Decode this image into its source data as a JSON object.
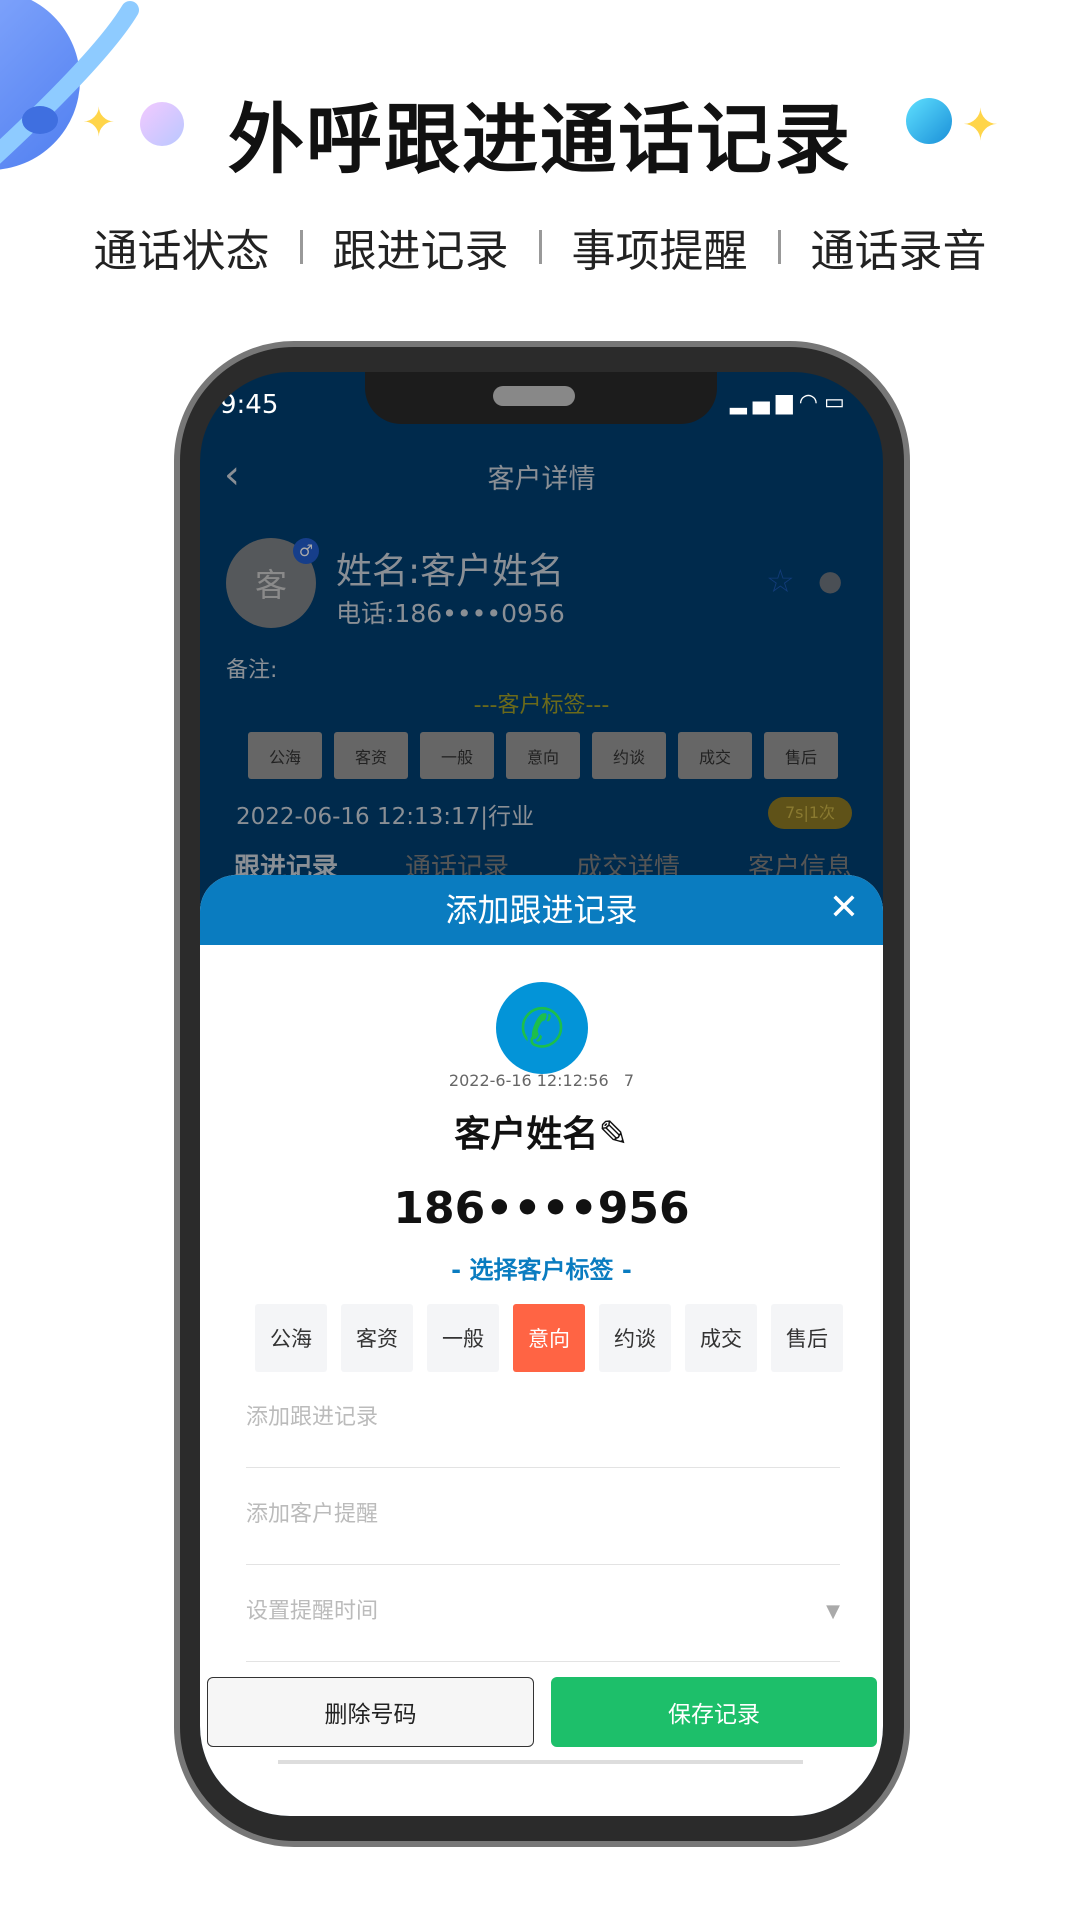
{
  "banner": {
    "title": "外呼跟进通话记录",
    "features": [
      "通话状态",
      "跟进记录",
      "事项提醒",
      "通话录音"
    ]
  },
  "status_bar": {
    "time": "9:45"
  },
  "detail": {
    "header_title": "客户详情",
    "avatar_text": "客",
    "name": "姓名:客户姓名",
    "phone": "电话:186••••0956",
    "remark_label": "备注:",
    "tags_title": "---客户标签---",
    "tags": [
      "公海",
      "客资",
      "一般",
      "意向",
      "约谈",
      "成交",
      "售后"
    ],
    "record_line": "2022-06-16 12:13:17|行业",
    "badge": "7s|1次",
    "tabs": [
      "跟进记录",
      "通话记录",
      "成交详情",
      "客户信息"
    ]
  },
  "modal": {
    "title": "添加跟进记录",
    "call_time": "2022-6-16 12:12:56   7",
    "customer_name": "客户姓名",
    "phone_number": "186••••956",
    "select_tags_label": "- 选择客户标签 -",
    "tags": [
      "公海",
      "客资",
      "一般",
      "意向",
      "约谈",
      "成交",
      "售后"
    ],
    "selected_tag": "意向",
    "followup_placeholder": "添加跟进记录",
    "reminder_placeholder": "添加客户提醒",
    "time_placeholder": "设置提醒时间",
    "delete_label": "删除号码",
    "save_label": "保存记录"
  },
  "colors": {
    "modal_header": "#0a7cc0",
    "selected_tag": "#ff6444",
    "save_button": "#1dbf6a",
    "tag_label": "#0a7cc0"
  }
}
